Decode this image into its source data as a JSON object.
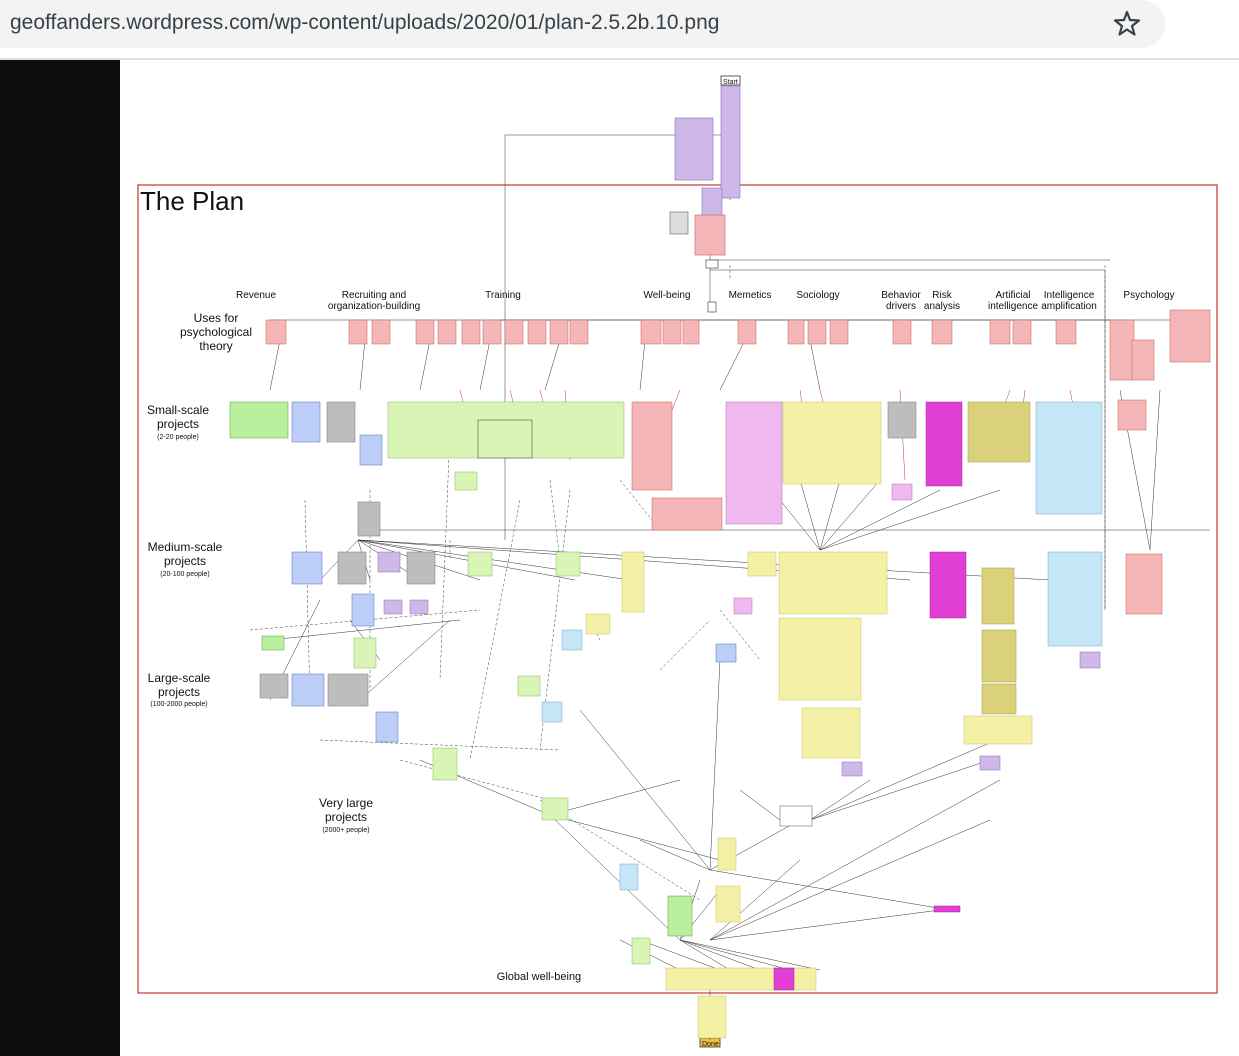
{
  "browser": {
    "url": "geoffanders.wordpress.com/wp-content/uploads/2020/01/plan-2.5.2b.10.png",
    "bookmark_icon": "star-icon"
  },
  "plan": {
    "title": "The Plan",
    "start_label": "Start",
    "done_label": "Done",
    "column_headers": [
      "Revenue",
      "Recruiting and organization-building",
      "Training",
      "Well-being",
      "Memetics",
      "Sociology",
      "Behavior drivers",
      "Risk analysis",
      "Artificial intelligence",
      "Intelligence amplification",
      "Psychology"
    ],
    "row_labels": {
      "uses": "Uses for psychological theory",
      "small": "Small-scale projects",
      "small_sub": "(2-20 people)",
      "medium": "Medium-scale projects",
      "medium_sub": "(20-100 people)",
      "large": "Large-scale projects",
      "large_sub": "(100-2000 people)",
      "very_large": "Very large projects",
      "very_large_sub": "(2000+ people)"
    },
    "footer_label": "Global well-being",
    "colors": {
      "frame": "#c0392b",
      "purple": "#cdb8e8",
      "red": "#f4b6b6",
      "green": "#b9ef9d",
      "blue": "#bccdf7",
      "grey": "#bdbdbd",
      "lightgreen": "#d8f5b5",
      "pink": "#efb8ef",
      "yellow": "#f4f1a6",
      "magenta": "#e23fd4",
      "olive": "#d9d27a",
      "skyblue": "#c5e6f6",
      "orange": "#f0c040"
    }
  }
}
